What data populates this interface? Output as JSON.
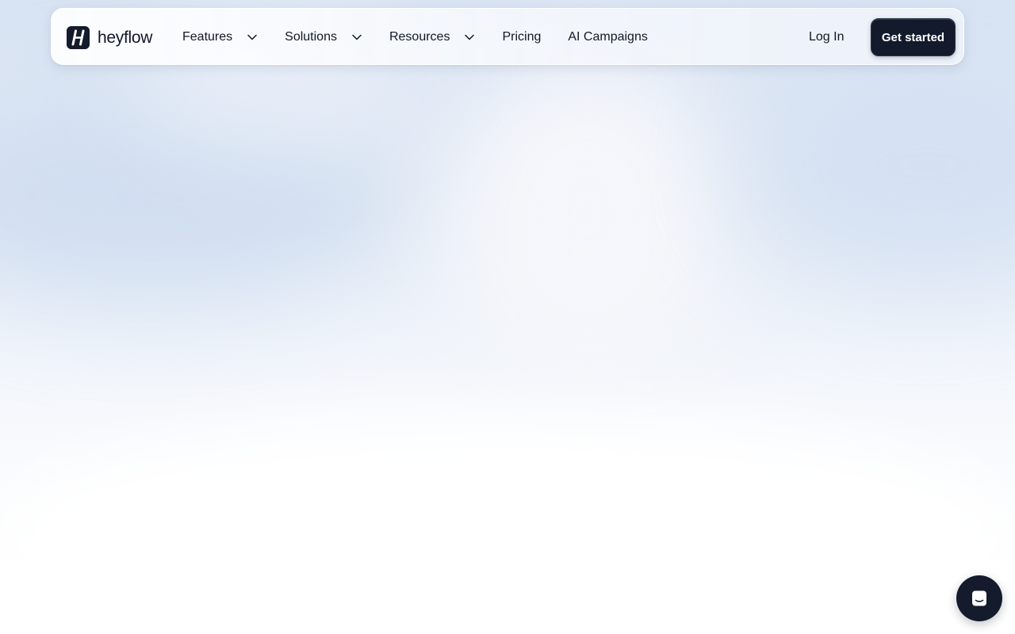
{
  "brand": {
    "name": "heyflow",
    "logo_icon": "heyflow-logo-icon"
  },
  "nav": {
    "items": [
      {
        "label": "Features",
        "has_dropdown": true
      },
      {
        "label": "Solutions",
        "has_dropdown": true
      },
      {
        "label": "Resources",
        "has_dropdown": true
      },
      {
        "label": "Pricing",
        "has_dropdown": false
      },
      {
        "label": "AI Campaigns",
        "has_dropdown": false
      }
    ],
    "dropdown_icon": "chevron-down-icon"
  },
  "actions": {
    "login_label": "Log In",
    "cta_label": "Get started"
  },
  "chat": {
    "icon": "chat-icon"
  },
  "colors": {
    "brand_dark": "#131b2c",
    "text": "#111827",
    "background_top": "#d8e3f3",
    "background_bottom": "#ffffff"
  }
}
